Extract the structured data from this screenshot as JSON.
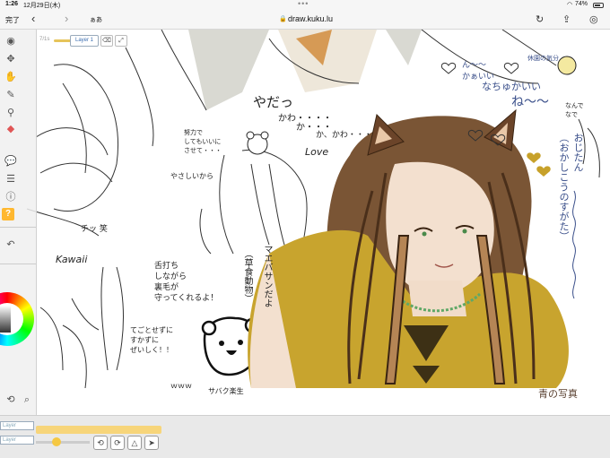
{
  "status": {
    "time": "1:26",
    "date": "12月29日(木)",
    "battery_pct": "74%",
    "battery_level": 0.74
  },
  "safari": {
    "done_label": "完了",
    "reader_label": "ぁあ",
    "url": "draw.kuku.lu"
  },
  "toolbar": {
    "size_label": "7/1s",
    "layer_label": "Layer 1"
  },
  "left_panel": {
    "help_label": "?"
  },
  "bottom": {
    "layer_chip_1": "Layer",
    "layer_chip_2": "Layer"
  },
  "canvas_text": {
    "yada": "やだっ",
    "kawa": "かわ・・・・",
    "ka1": "か・・・",
    "ka2": "か、かわ・・・",
    "nn_kawaii": "ん～～\nかぁいい",
    "soin": "休園の気分",
    "nachu": "なちゅかいい",
    "ne": "ね～～",
    "nande": "なんで\nなで",
    "ojitan": "おじたん\n（おかしこうのすがた）",
    "sign": "青の写真",
    "love": "Love",
    "yasashii": "やさしいから",
    "kore_ni": "努力で\nしてもいいに\nさせて・・・",
    "kawaii": "Kawaii",
    "chitsu": "チッ 笑",
    "kawari": "舌打ち\nしながら\n裏毛が\n守ってくれるよ！",
    "maebasan": "マエバサンだよ",
    "kusashoku": "（草食動物）",
    "kutsu": "てごとせずに\nすかずに\nぜいしく！！",
    "www": "ｗｗｗ",
    "sabaku": "サバク楽生"
  }
}
